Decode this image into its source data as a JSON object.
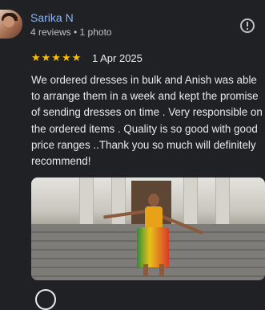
{
  "reviewer": {
    "name": "Sarika N",
    "meta": "4 reviews • 1 photo"
  },
  "rating": {
    "stars": 5,
    "stars_text": "★★★★★",
    "date": "1 Apr 2025"
  },
  "review": {
    "lines": [
      "We ordered dresses in bulk and Anish was able",
      "to arrange them in a week and kept the promise",
      "of sending dresses on time . Very responsible on",
      "the ordered items . Quality is so good with good",
      "price ranges ..Thank you so much will definitely",
      "recommend!"
    ]
  },
  "colors": {
    "background": "#202124",
    "name": "#8ab4f8",
    "star": "#fbbc04"
  },
  "icons": {
    "info": "info-icon"
  }
}
